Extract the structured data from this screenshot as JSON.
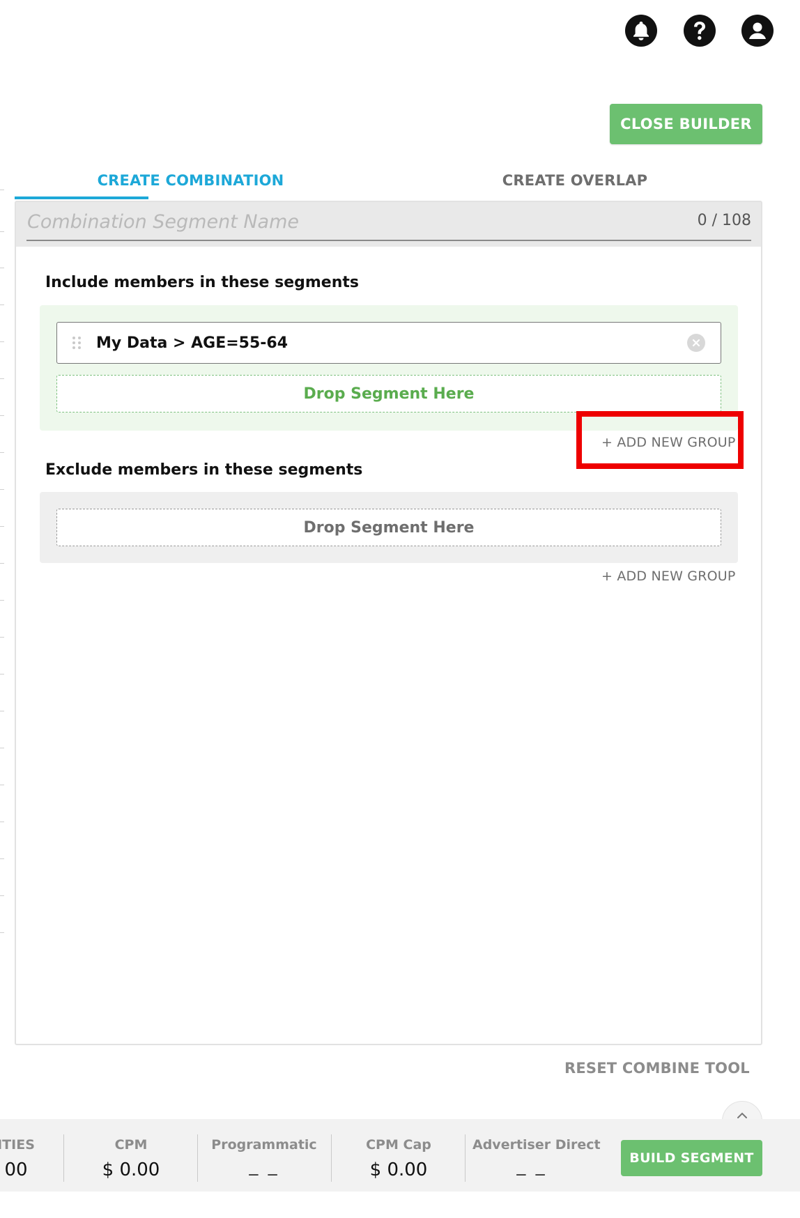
{
  "header": {
    "icons": [
      "bell-icon",
      "help-icon",
      "account-icon"
    ]
  },
  "builder": {
    "close_label": "CLOSE BUILDER",
    "tabs": [
      {
        "label": "CREATE COMBINATION",
        "active": true
      },
      {
        "label": "CREATE OVERLAP",
        "active": false
      }
    ],
    "name_placeholder": "Combination Segment Name",
    "name_value": "",
    "name_counter": "0 / 108",
    "include": {
      "title": "Include members in these segments",
      "segments": [
        {
          "label": "My Data > AGE=55-64"
        }
      ],
      "drop_label": "Drop Segment Here",
      "add_group_label": "+ ADD NEW GROUP"
    },
    "exclude": {
      "title": "Exclude members in these segments",
      "drop_label": "Drop Segment Here",
      "add_group_label": "+ ADD NEW GROUP"
    },
    "reset_label": "RESET COMBINE TOOL"
  },
  "footer": {
    "stats": [
      {
        "label": "ITIES",
        "value": "00"
      },
      {
        "label": "CPM",
        "value": "$ 0.00"
      },
      {
        "label": "Programmatic",
        "value": "_ _"
      },
      {
        "label": "CPM Cap",
        "value": "$ 0.00"
      },
      {
        "label": "Advertiser Direct",
        "value": "_ _"
      }
    ],
    "build_label": "BUILD SEGMENT"
  },
  "colors": {
    "accent_blue": "#1da8d8",
    "button_green": "#6cc070",
    "drop_green": "#5aac4e",
    "highlight_red": "#ee0000"
  }
}
